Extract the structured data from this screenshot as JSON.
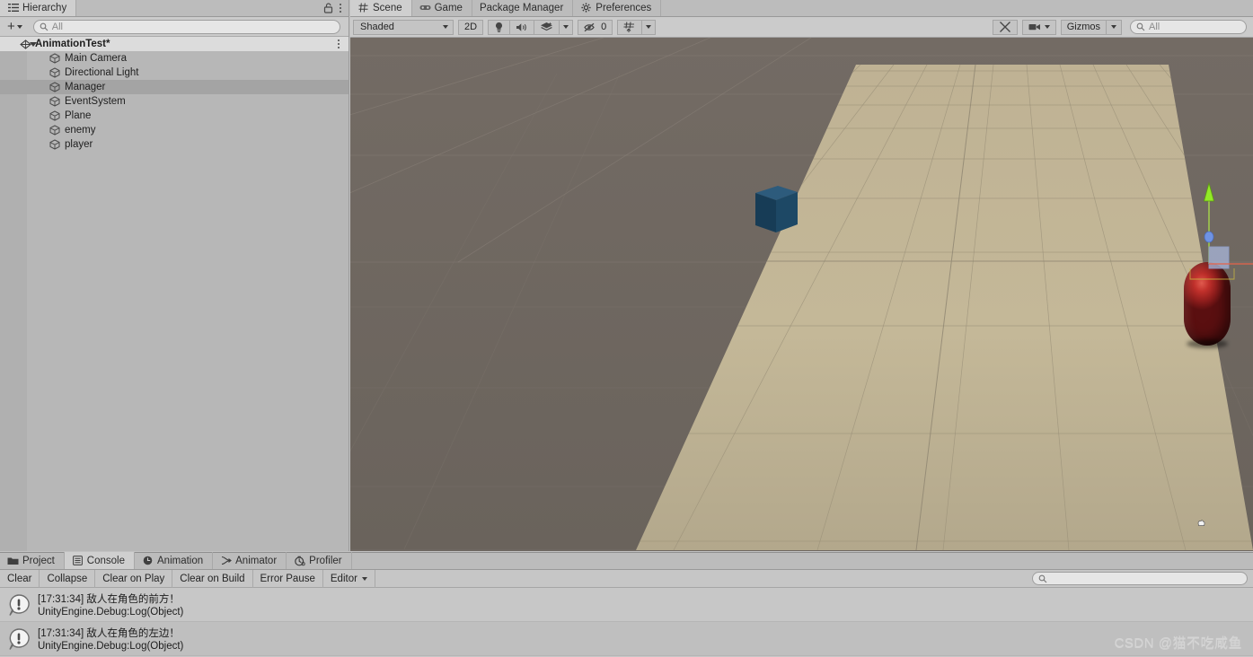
{
  "hierarchy": {
    "tab_label": "Hierarchy",
    "tab_icon": "hierarchy-icon",
    "lock_icon": "lock-open-icon",
    "menu_icon": "kebab-menu-icon",
    "add_label": "+",
    "search_placeholder": "All",
    "scene_name": "AnimationTest*",
    "items": [
      {
        "label": "Main Camera",
        "selected": false
      },
      {
        "label": "Directional Light",
        "selected": false
      },
      {
        "label": "Manager",
        "selected": true
      },
      {
        "label": "EventSystem",
        "selected": false
      },
      {
        "label": "Plane",
        "selected": false
      },
      {
        "label": "enemy",
        "selected": false
      },
      {
        "label": "player",
        "selected": false
      }
    ]
  },
  "scene": {
    "tabs": [
      {
        "label": "Scene",
        "icon": "grid-icon",
        "active": true
      },
      {
        "label": "Game",
        "icon": "gamepad-icon",
        "active": false
      },
      {
        "label": "Package Manager",
        "icon": "none",
        "active": false
      },
      {
        "label": "Preferences",
        "icon": "gear-icon",
        "active": false
      }
    ],
    "toolbar": {
      "draw_mode": "Shaded",
      "two_d_label": "2D",
      "lighting_icon": "lightbulb-icon",
      "audio_icon": "speaker-icon",
      "effects_icon": "effects-icon",
      "hidden_count": "0",
      "hidden_icon": "eye-off-icon",
      "grid_icon": "grid-visibility-icon",
      "tools_icon": "tools-icon",
      "camera_icon": "scene-camera-icon",
      "gizmos_label": "Gizmos",
      "search_placeholder": "All"
    },
    "objects": {
      "capsule_name": "player",
      "capsule_color": "#b5302b",
      "cube_name": "enemy",
      "cube_color": "#1f4d6b",
      "plane_color": "#c2b695",
      "background_color": "#6e6761",
      "gizmo": {
        "y_axis_color": "#8ce61c",
        "x_axis_color": "#e8472c",
        "z_axis_color": "#6e8fe0"
      }
    }
  },
  "console": {
    "tabs": [
      {
        "label": "Project",
        "icon": "folder-icon",
        "active": false
      },
      {
        "label": "Console",
        "icon": "console-icon",
        "active": true
      },
      {
        "label": "Animation",
        "icon": "clock-icon",
        "active": false
      },
      {
        "label": "Animator",
        "icon": "animator-icon",
        "active": false
      },
      {
        "label": "Profiler",
        "icon": "profiler-icon",
        "active": false
      }
    ],
    "buttons": [
      {
        "label": "Clear",
        "pressed": false
      },
      {
        "label": "Collapse",
        "pressed": false
      },
      {
        "label": "Clear on Play",
        "pressed": false
      },
      {
        "label": "Clear on Build",
        "pressed": false
      },
      {
        "label": "Error Pause",
        "pressed": false
      },
      {
        "label": "Editor",
        "pressed": false,
        "has_dropdown": true
      }
    ],
    "search_placeholder": "",
    "logs": [
      {
        "icon": "log-info-icon",
        "message": "[17:31:34] 敌人在角色的前方！",
        "stack": "UnityEngine.Debug:Log(Object)"
      },
      {
        "icon": "log-info-icon",
        "message": "[17:31:34] 敌人在角色的左边！",
        "stack": "UnityEngine.Debug:Log(Object)"
      }
    ]
  },
  "watermark": {
    "text": "CSDN @猫不吃咸鱼"
  }
}
